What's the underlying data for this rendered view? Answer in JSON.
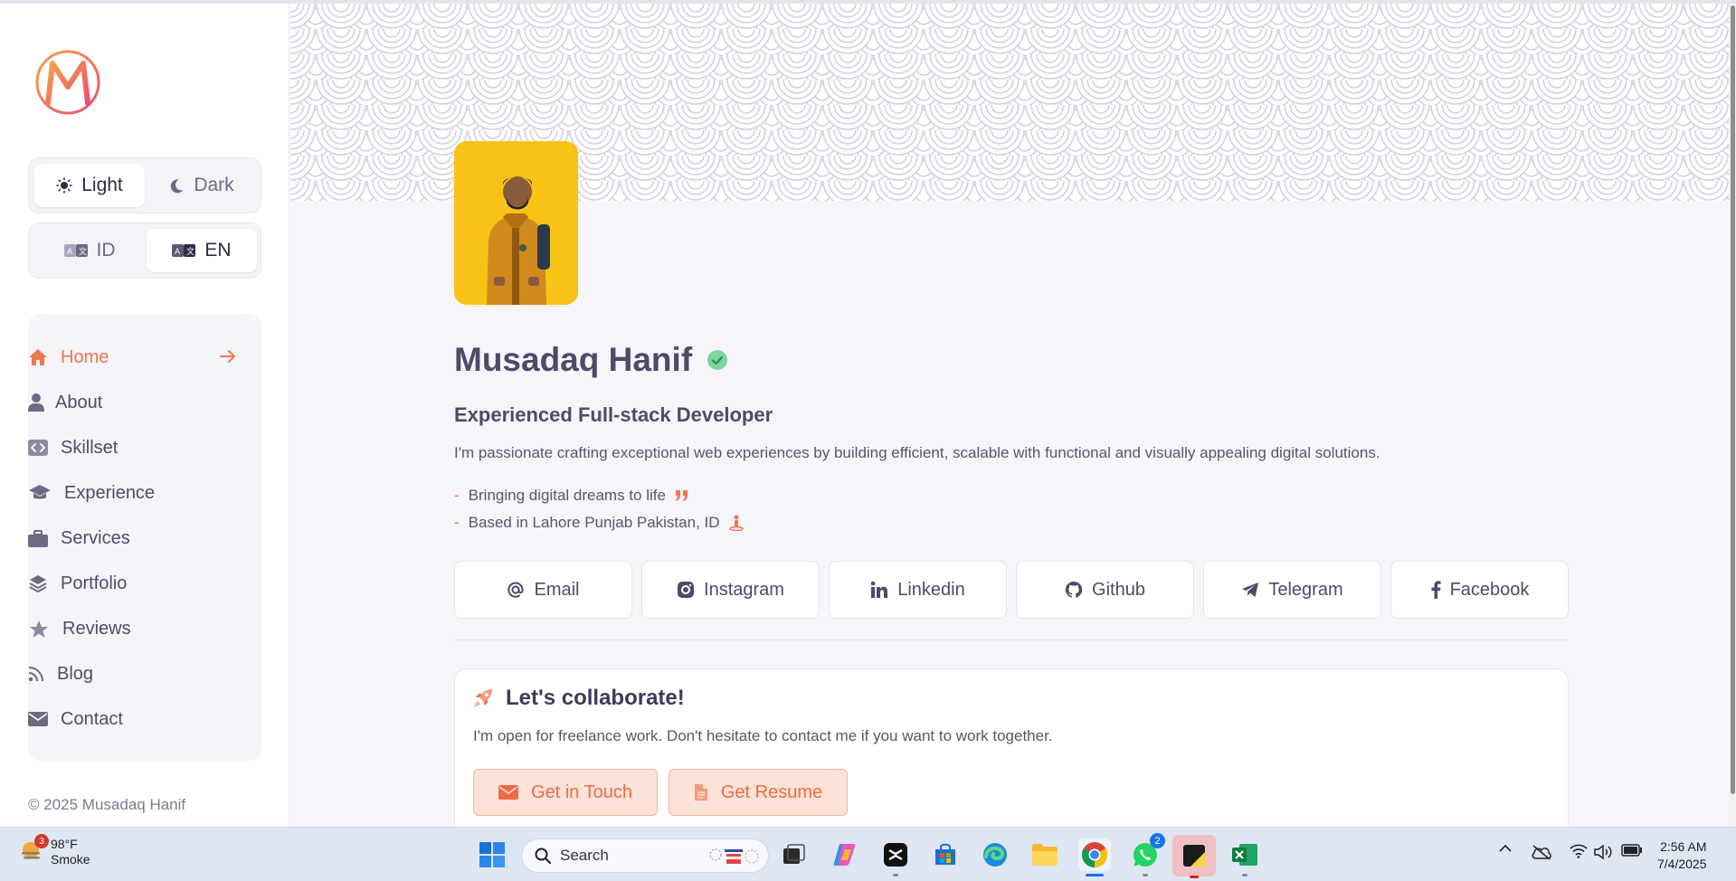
{
  "sidebar": {
    "theme": {
      "light_label": "Light",
      "dark_label": "Dark",
      "active": "light"
    },
    "language": {
      "id_label": "ID",
      "en_label": "EN",
      "active": "en"
    },
    "nav": [
      {
        "label": "Home",
        "icon": "home-icon",
        "active": true
      },
      {
        "label": "About",
        "icon": "user-icon"
      },
      {
        "label": "Skillset",
        "icon": "code-icon"
      },
      {
        "label": "Experience",
        "icon": "graduation-cap-icon"
      },
      {
        "label": "Services",
        "icon": "briefcase-icon"
      },
      {
        "label": "Portfolio",
        "icon": "layers-icon"
      },
      {
        "label": "Reviews",
        "icon": "star-icon"
      },
      {
        "label": "Blog",
        "icon": "rss-icon"
      },
      {
        "label": "Contact",
        "icon": "envelope-icon"
      }
    ],
    "copyright": "© 2025 Musadaq Hanif"
  },
  "profile": {
    "name": "Musadaq Hanif",
    "role": "Experienced Full-stack Developer",
    "bio": "I'm passionate crafting exceptional web experiences by building efficient, scalable with functional and visually appealing digital solutions.",
    "bullets": [
      "Bringing digital dreams to life",
      "Based in Lahore Punjab Pakistan, ID"
    ]
  },
  "socials": [
    {
      "label": "Email",
      "icon": "at-icon"
    },
    {
      "label": "Instagram",
      "icon": "instagram-icon"
    },
    {
      "label": "Linkedin",
      "icon": "linkedin-icon"
    },
    {
      "label": "Github",
      "icon": "github-icon"
    },
    {
      "label": "Telegram",
      "icon": "telegram-icon"
    },
    {
      "label": "Facebook",
      "icon": "facebook-icon"
    }
  ],
  "collab": {
    "title": "Let's collaborate!",
    "text": "I'm open for freelance work. Don't hesitate to contact me if you want to work together.",
    "touch_label": "Get in Touch",
    "resume_label": "Get Resume"
  },
  "taskbar": {
    "weather_temp": "98°F",
    "weather_desc": "Smoke",
    "weather_badge": "3",
    "search_placeholder": "Search",
    "whatsapp_badge": "2",
    "time": "2:56 AM",
    "date": "7/4/2025"
  },
  "colors": {
    "accent": "#f0764f",
    "text": "#4c4b6a",
    "background": "#f6f5fa"
  }
}
